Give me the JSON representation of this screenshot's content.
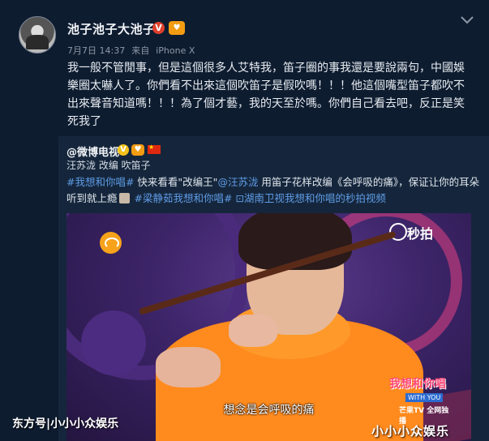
{
  "post": {
    "username": "池子池子大池子",
    "verified_badge": "V",
    "meta": {
      "date": "7月7日 14:37",
      "source_prefix": "来自",
      "source": "iPhone X"
    },
    "text": "我一般不管閒事，但是這個很多人艾特我，笛子圈的事我還是要說兩句，中國娛樂圈太嚇人了。你們看不出來這個吹笛子是假吹嗎！！！他這個嘴型笛子都吹不出來聲音知道嗎！！！為了個才藝，我的天至於嗎。你們自己看去吧，反正是笑死我了"
  },
  "repost": {
    "username": "@微博电视",
    "tags_line": "汪苏泷 改编 吹笛子",
    "hashtag1": "#我想和你唱#",
    "text1": " 快来看看\"改编王\"",
    "mention": "@汪苏泷",
    "text2": " 用笛子花样改编《会呼吸的痛》，保证让你的耳朵听到就上瘾",
    "hashtag2": "#梁静茹我想和你唱#",
    "video_link": "湖南卫视我想和你唱的秒拍视频"
  },
  "video": {
    "brand": "秒拍",
    "subtitle": "想念是会呼吸的痛",
    "show_title": "我想和你唱",
    "show_sub": "WITH YOU",
    "channel": "芒果TV 全网独播"
  },
  "watermarks": {
    "left": "东方号|小小小众娱乐",
    "right": "小小小众娱乐"
  },
  "colors": {
    "background": "#0e1c30",
    "link": "#5f9ce6",
    "repost_bg": "#15263c"
  }
}
